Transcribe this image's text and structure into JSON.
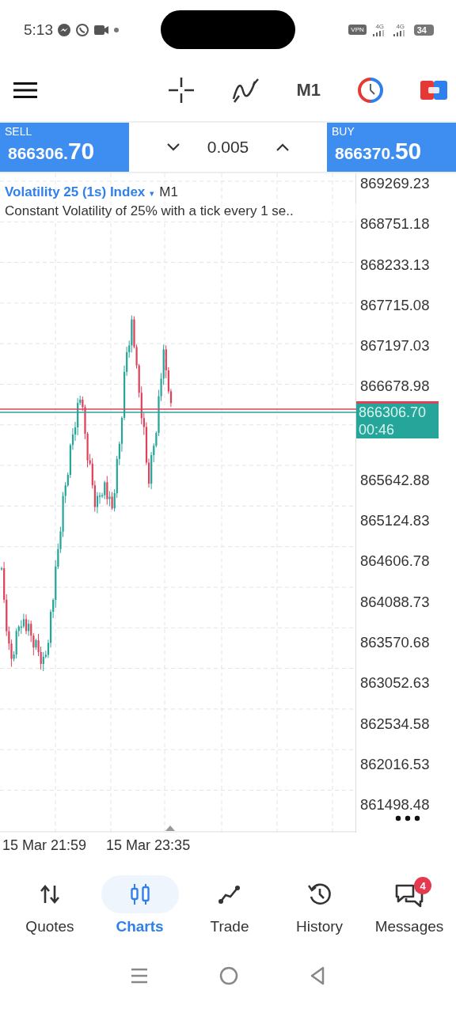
{
  "status_bar": {
    "time": "5:13",
    "vpn": "VPN",
    "networks": [
      "4G",
      "4G"
    ],
    "battery": "34"
  },
  "toolbar": {
    "timeframe": "M1"
  },
  "trade_panel": {
    "sell": {
      "label": "SELL",
      "price": "866306.",
      "price_big": "70"
    },
    "volume": "0.005",
    "buy": {
      "label": "BUY",
      "price": "866370.",
      "price_big": "50"
    }
  },
  "chart": {
    "symbol": "Volatility 25 (1s) Index",
    "dropdown": "▾",
    "timeframe": "M1",
    "description": "Constant Volatility of 25% with a tick every 1 se..",
    "price_labels_above": [
      "869269.23",
      "868751.18",
      "868233.13",
      "867715.08",
      "867197.03",
      "866678.98"
    ],
    "current_price": "866306.70",
    "countdown": "00:46",
    "price_labels_below": [
      "865642.88",
      "865124.83",
      "864606.78",
      "864088.73",
      "863570.68",
      "863052.63",
      "862534.58",
      "862016.53",
      "861498.48"
    ],
    "time_labels": [
      "15 Mar 21:59",
      "15 Mar 23:35"
    ]
  },
  "bottom_nav": [
    {
      "kind": "quotes",
      "label": "Quotes",
      "selected": false
    },
    {
      "kind": "charts",
      "label": "Charts",
      "selected": true
    },
    {
      "kind": "trade",
      "label": "Trade",
      "selected": false
    },
    {
      "kind": "history",
      "label": "History",
      "selected": false
    },
    {
      "kind": "messages",
      "label": "Messages",
      "selected": false,
      "badge": "4"
    }
  ]
}
